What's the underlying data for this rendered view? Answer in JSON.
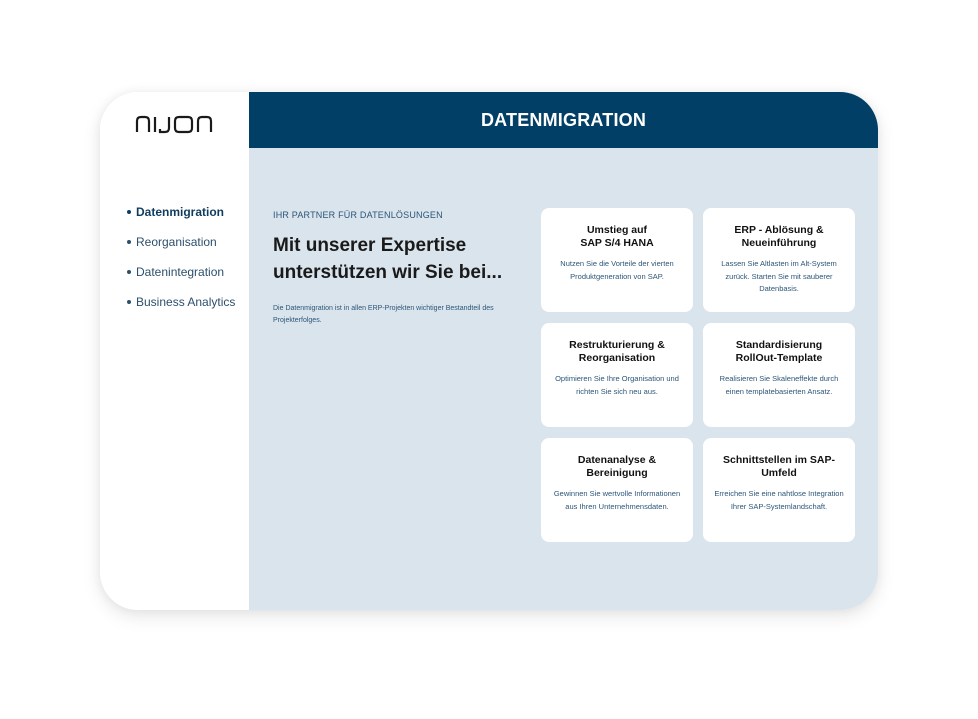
{
  "brand": {
    "logo_text": "NIJON"
  },
  "header": {
    "title": "DATENMIGRATION"
  },
  "sidebar": {
    "items": [
      {
        "label": "Datenmigration",
        "active": true
      },
      {
        "label": "Reorganisation",
        "active": false
      },
      {
        "label": "Datenintegration",
        "active": false
      },
      {
        "label": "Business Analytics",
        "active": false
      }
    ]
  },
  "intro": {
    "eyebrow": "IHR PARTNER FÜR DATENLÖSUNGEN",
    "headline_line1": "Mit unserer Expertise",
    "headline_line2": "unterstützen wir Sie bei...",
    "description": "Die Datenmigration ist in allen ERP-Projekten wichtiger Bestandteil des Projekterfolges."
  },
  "cards": [
    {
      "title_line1": "Umstieg auf",
      "title_line2": "SAP S/4 HANA",
      "text": "Nutzen Sie die Vorteile der vierten Produktgeneration von SAP."
    },
    {
      "title_line1": "ERP - Ablösung &",
      "title_line2": "Neueinführung",
      "text": "Lassen Sie Altlasten im Alt-System zurück. Starten Sie mit sauberer Datenbasis."
    },
    {
      "title_line1": "Restrukturierung &",
      "title_line2": "Reorganisation",
      "text": "Optimieren Sie Ihre Organisation und richten Sie sich neu aus."
    },
    {
      "title_line1": "Standardisierung",
      "title_line2": "RollOut-Template",
      "text": "Realisieren Sie Skaleneffekte durch einen templatebasierten Ansatz."
    },
    {
      "title_line1": "Datenanalyse &",
      "title_line2": "Bereinigung",
      "text": "Gewinnen Sie wertvolle Informationen aus Ihren Unternehmensdaten."
    },
    {
      "title_line1": "Schnittstellen im SAP-",
      "title_line2": "Umfeld",
      "text": "Erreichen Sie eine nahtlose Integration Ihrer SAP-Systemlandschaft."
    }
  ],
  "colors": {
    "header_bg": "#023f66",
    "main_bg": "#dae4ec",
    "accent_text": "#2c5578"
  }
}
